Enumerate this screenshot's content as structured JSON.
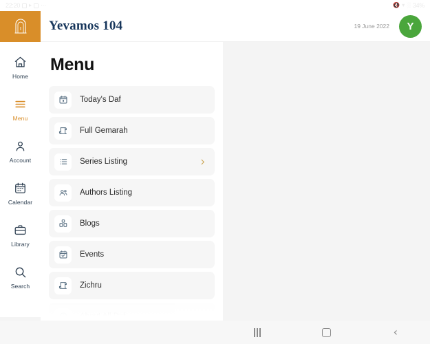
{
  "statusbar": {
    "time": "22:20",
    "left_icons": [
      "screenshot-icon",
      "app-icon",
      "gallery-icon",
      "dots-icon"
    ],
    "right_icons": [
      "mute-icon",
      "wifi-icon",
      "signal-icon"
    ],
    "battery": "34%"
  },
  "header": {
    "logo": "gate-arch-logo",
    "title": "Yevamos 104",
    "date": "19 June 2022",
    "avatar_initial": "Y",
    "avatar_color": "#4aa63c",
    "title_color": "#17365b",
    "logo_bg": "#d98e29"
  },
  "rail": {
    "items": [
      {
        "label": "Home",
        "icon": "home-icon",
        "active": false
      },
      {
        "label": "Menu",
        "icon": "hamburger-icon",
        "active": true
      },
      {
        "label": "Account",
        "icon": "person-icon",
        "active": false
      },
      {
        "label": "Calendar",
        "icon": "calendar-icon",
        "active": false
      },
      {
        "label": "Library",
        "icon": "briefcase-icon",
        "active": false
      },
      {
        "label": "Search",
        "icon": "search-icon",
        "active": false
      }
    ],
    "active_color": "#d98e29",
    "inactive_color": "#2c3e50"
  },
  "panel": {
    "title": "Menu",
    "items": [
      {
        "label": "Today's Daf",
        "icon": "calendar-day-icon",
        "chevron": false
      },
      {
        "label": "Full Gemarah",
        "icon": "scroll-icon",
        "chevron": false
      },
      {
        "label": "Series Listing",
        "icon": "list-icon",
        "chevron": true
      },
      {
        "label": "Authors Listing",
        "icon": "people-group-icon",
        "chevron": false
      },
      {
        "label": "Blogs",
        "icon": "blog-icon",
        "chevron": false
      },
      {
        "label": "Events",
        "icon": "calendar-check-icon",
        "chevron": false
      },
      {
        "label": "Zichru",
        "icon": "scroll-icon",
        "chevron": false
      },
      {
        "label": "About All Daf",
        "icon": "info-icon",
        "chevron": false
      }
    ],
    "chevron_color": "#c9a14a",
    "row_bg": "#f6f6f6"
  },
  "navbar": {
    "recents_label": "recents-button",
    "home_label": "home-button",
    "back_label": "back-button"
  }
}
